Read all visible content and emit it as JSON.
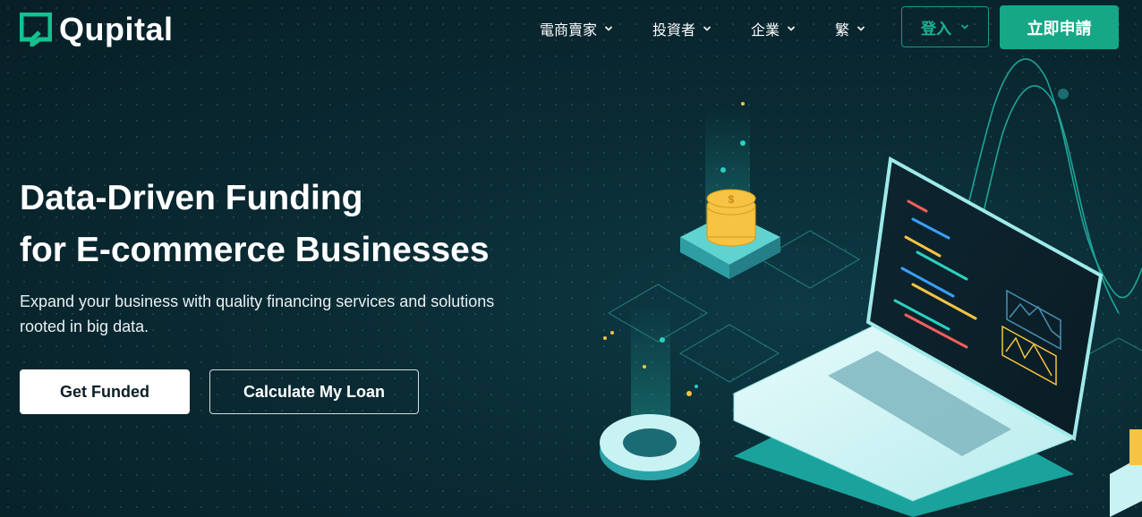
{
  "brand": {
    "name": "Qupital"
  },
  "nav": {
    "items": [
      {
        "label": "電商賣家"
      },
      {
        "label": "投資者"
      },
      {
        "label": "企業"
      },
      {
        "label": "繁"
      }
    ],
    "login_label": "登入",
    "apply_label": "立即申請"
  },
  "hero": {
    "title_line1": "Data-Driven Funding",
    "title_line2": "for E-commerce Businesses",
    "subtitle": "Expand your business with quality financing services and solutions rooted in big data.",
    "primary_cta": "Get Funded",
    "secondary_cta": "Calculate My Loan"
  },
  "colors": {
    "accent": "#16a886",
    "background": "#0a2a33",
    "login_text": "#19b690"
  }
}
